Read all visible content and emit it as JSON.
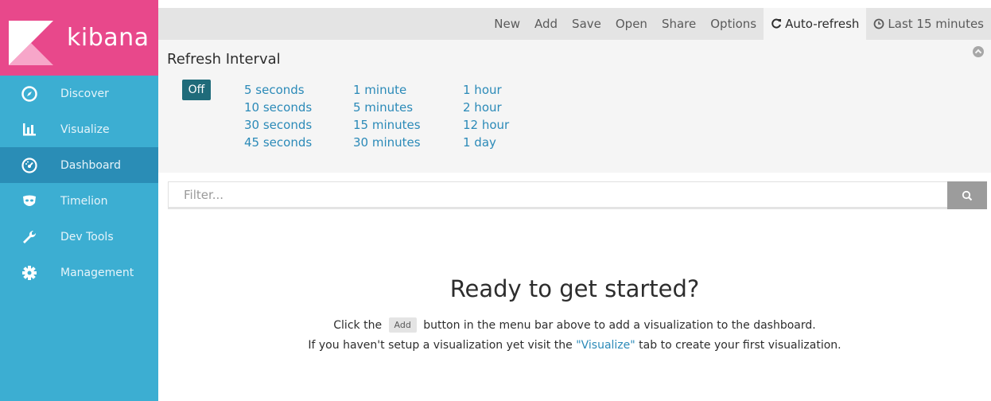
{
  "app": {
    "name": "kibana"
  },
  "colors": {
    "brand": "#e8488b",
    "sidebar": "#3caed2",
    "sidebar_active": "#2a8db6",
    "link": "#2b8ab8",
    "off_button": "#1f6b7a"
  },
  "sidebar": {
    "items": [
      {
        "label": "Discover",
        "icon": "compass-icon"
      },
      {
        "label": "Visualize",
        "icon": "bar-chart-icon"
      },
      {
        "label": "Dashboard",
        "icon": "dashboard-gauge-icon",
        "active": true
      },
      {
        "label": "Timelion",
        "icon": "timelion-mask-icon"
      },
      {
        "label": "Dev Tools",
        "icon": "wrench-icon"
      },
      {
        "label": "Management",
        "icon": "gear-icon"
      }
    ]
  },
  "menu": {
    "new": "New",
    "add": "Add",
    "save": "Save",
    "open": "Open",
    "share": "Share",
    "options": "Options",
    "auto_refresh": "Auto-refresh",
    "time_range": "Last 15 minutes"
  },
  "refresh_panel": {
    "title": "Refresh Interval",
    "off": "Off",
    "columns": [
      [
        "5 seconds",
        "10 seconds",
        "30 seconds",
        "45 seconds"
      ],
      [
        "1 minute",
        "5 minutes",
        "15 minutes",
        "30 minutes"
      ],
      [
        "1 hour",
        "2 hour",
        "12 hour",
        "1 day"
      ]
    ]
  },
  "filter": {
    "placeholder": "Filter..."
  },
  "empty_state": {
    "title": "Ready to get started?",
    "line1_before": "Click the",
    "line1_button": "Add",
    "line1_after": "button in the menu bar above to add a visualization to the dashboard.",
    "line2_before": "If you haven't setup a visualization yet visit the",
    "line2_link": "\"Visualize\"",
    "line2_after": "tab to create your first visualization."
  }
}
